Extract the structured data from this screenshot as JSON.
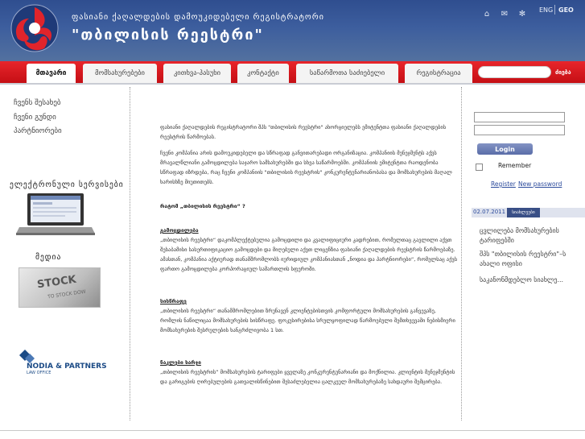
{
  "header": {
    "tagline": "ფასიანი ქაღალდების დამოუკიდებელი რეგისტრატორი",
    "brand": "\"თბილისის რეესტრი\"",
    "icons": [
      "home-icon",
      "mail-icon",
      "sitemap-icon"
    ],
    "lang_eng": "ENG",
    "lang_geo": "GEO"
  },
  "nav": {
    "tabs": [
      {
        "label": "მთავარი",
        "active": true
      },
      {
        "label": "მომსახურებები"
      },
      {
        "label": "კითხვა-პასუხი"
      },
      {
        "label": "კონტაქტი"
      },
      {
        "label": "საწარმოთა საძიებელი"
      },
      {
        "label": "რეგისტრაცია"
      }
    ],
    "search_button": "ძიება"
  },
  "left": {
    "links": [
      "ჩვენს შესახებ",
      "ჩვენი გუნდი",
      "პარტნიორები"
    ],
    "electronic_services": "ელექტრონული სერვისები",
    "media": "მედია",
    "stock_text": "STOCK",
    "stock_sub": "TO STOCK DOW",
    "partner_name": "NODIA & PARTNERS",
    "partner_sub": "LAW OFFICE"
  },
  "main": {
    "intro": "ფასიანი ქაღალდების რეგისტრატორი შპს \"თბილისის რეესტრი\" ახორციელებს ემიტენტთა ფასიანი ქაღალდების რეესტრის წარმოებას.",
    "about": "ჩვენი კომპანია არის დამოუკიდებელი და სწრაფად განვითარებადი ორგანიზაცია. კომპანიის მენეჯმენტს აქვს მრავალწლიანი გამოცდილება საჯარო სამსახურებში და სხვა საწარმოებში. კომპანიის ემიტენტთა რაოდენობა სწრაფად იზრდება, რაც ჩვენი კომპანიის \"თბილისის რეესტრის\" კონკურენტუნარიანობასა და მომსახურების მაღალ ხარისხზე მიუთითებს.",
    "why_heading": "რატომ „თბილისის რეესტრი“ ?",
    "experience_heading": "გამოცდილება",
    "experience": "„თბილისის რეესტრი“ დაკომპლექტებულია გამოცდილი და კვალიფიციური კადრებით, რომელთაც გავლილი აქვთ შესაბამისი სასერთიფიკაციო გამოცდები და მიღებული აქვთ ლიცენზია ფასიანი ქაღალდების რეესტრის წარმოებაზე. ამასთან, კომპანია აქტიურად თანამშრომლობს იურიდიულ კომპანიასთან „ნოდია და პარტნიორები“, რომელსაც აქვს ფართო გამოცდილება კორპორაციულ სამართლის სფეროში.",
    "speed_heading": "სისწრაფე",
    "speed": "„თბილისის რეესტრი“ თანამშრომლებით ზრუნავენ კლიენტებისთვის კომფორტული მომსახურების განვევაზე, რომლის ნაწილიცაა მომსახურების სისწრაფე. ფოკუსირებისა სრულყოფილად წარმოებული შემთხვევაში ნებისმიერი მომსახურების შესრულების ხანგრძლივობა 1 სთ.",
    "price_heading": "ნაკლები ხარჯი",
    "price": "„თბილისის რეესტრის“ მომსახურების ტარიფები ყველაზე კონკურენტუნარიანი და მოქნილია. კლიენტის მენეჯმენტის და გარიგების ღირებულების გათვალისწინებით შესაძლებელია ცალკეულ მომსახურებაზე სახდაური შემცირება."
  },
  "login": {
    "button": "Login",
    "remember": "Remember",
    "register": "Register",
    "new_password": "New password"
  },
  "news": {
    "date": "02.07.2011",
    "tag": "სიახლეები",
    "items": [
      "ცვლილება მომსახურების ტარიფებში",
      "შპს \"თბილისის რეესტრი\"–ს ახალი ოფისი",
      "საკანონმდებლო სიახლე..."
    ]
  }
}
